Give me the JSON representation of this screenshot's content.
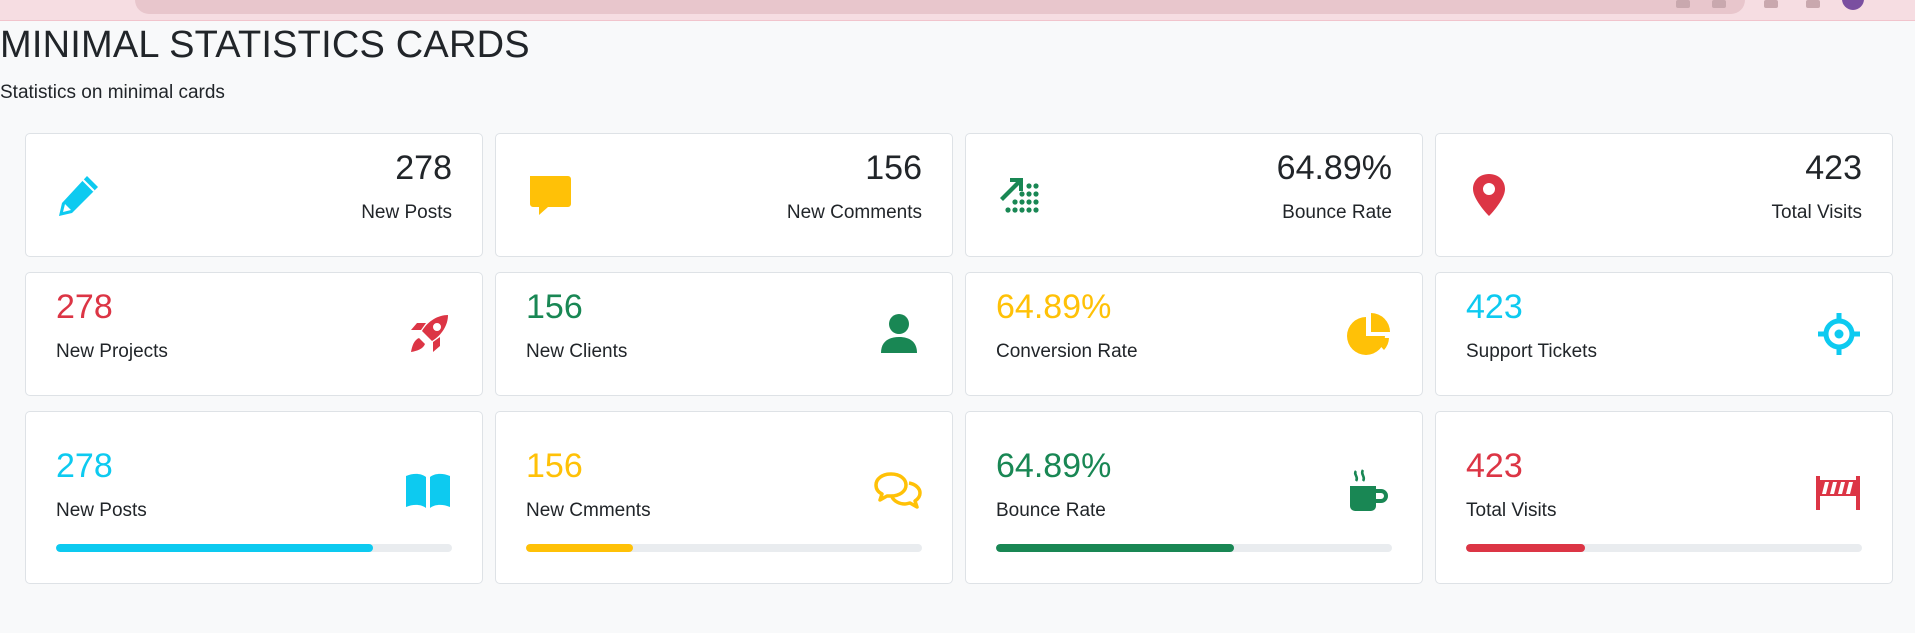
{
  "page": {
    "title": "MINIMAL STATISTICS CARDS",
    "subtitle": "Statistics on minimal cards"
  },
  "colors": {
    "info": "#0dcaf0",
    "warning": "#ffc107",
    "success": "#198754",
    "danger": "#dc3545",
    "text": "#212529"
  },
  "row1": [
    {
      "value": "278",
      "label": "New Posts",
      "icon": "pencil-icon",
      "color": "#0dcaf0"
    },
    {
      "value": "156",
      "label": "New Comments",
      "icon": "speech-bubble-icon",
      "color": "#ffc107"
    },
    {
      "value": "64.89%",
      "label": "Bounce Rate",
      "icon": "trend-up-icon",
      "color": "#198754"
    },
    {
      "value": "423",
      "label": "Total Visits",
      "icon": "map-pin-icon",
      "color": "#dc3545"
    }
  ],
  "row2": [
    {
      "value": "278",
      "label": "New Projects",
      "icon": "rocket-icon",
      "color": "#dc3545"
    },
    {
      "value": "156",
      "label": "New Clients",
      "icon": "user-icon",
      "color": "#198754"
    },
    {
      "value": "64.89%",
      "label": "Conversion Rate",
      "icon": "pie-chart-icon",
      "color": "#ffc107"
    },
    {
      "value": "423",
      "label": "Support Tickets",
      "icon": "crosshair-icon",
      "color": "#0dcaf0"
    }
  ],
  "row3": [
    {
      "value": "278",
      "label": "New Posts",
      "icon": "book-icon",
      "color": "#0dcaf0",
      "progress": 0.8
    },
    {
      "value": "156",
      "label": "New Cmments",
      "icon": "chat-bubbles-icon",
      "color": "#ffc107",
      "progress": 0.27
    },
    {
      "value": "64.89%",
      "label": "Bounce Rate",
      "icon": "coffee-mug-icon",
      "color": "#198754",
      "progress": 0.6
    },
    {
      "value": "423",
      "label": "Total Visits",
      "icon": "barrier-icon",
      "color": "#dc3545",
      "progress": 0.3
    }
  ]
}
